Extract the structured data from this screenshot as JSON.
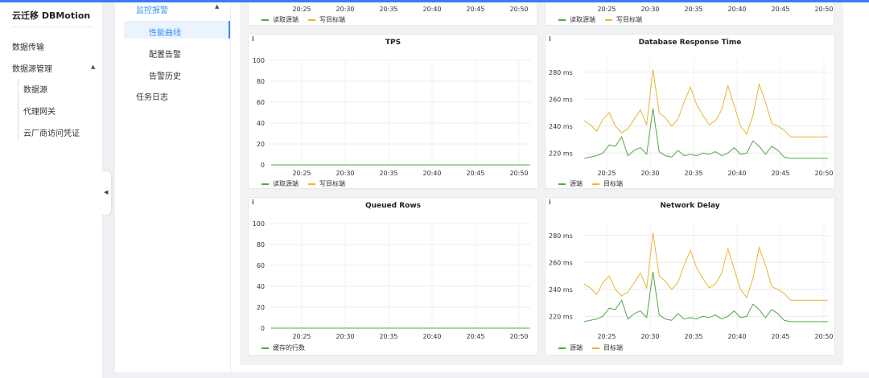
{
  "app": {
    "title": "云迁移 DBMotion"
  },
  "sidebar": {
    "items": [
      {
        "label": "数据传输"
      },
      {
        "label": "数据源管理"
      }
    ],
    "sub_items": [
      {
        "label": "数据源"
      },
      {
        "label": "代理网关"
      },
      {
        "label": "云厂商访问凭证"
      }
    ]
  },
  "secondary_menu": {
    "group": "监控报警",
    "items": [
      {
        "label": "性能曲线",
        "active": true
      },
      {
        "label": "配置告警"
      },
      {
        "label": "告警历史"
      }
    ],
    "other": "任务日志"
  },
  "colors": {
    "series_a": "#56a64b",
    "series_b": "#e5b82f",
    "active_menu": "#3a8ff0"
  },
  "top_partial": {
    "x_ticks": [
      "20:25",
      "20:30",
      "20:35",
      "20:40",
      "20:45",
      "20:50"
    ],
    "left_legend": [
      "读取源端",
      "写目标端"
    ],
    "right_legend": [
      "读取源端",
      "写目标端"
    ]
  },
  "chart_data": [
    {
      "type": "line",
      "title": "TPS",
      "x": [
        "20:25",
        "20:30",
        "20:35",
        "20:40",
        "20:45",
        "20:50"
      ],
      "y_ticks": [
        "0",
        "20",
        "40",
        "60",
        "80",
        "100"
      ],
      "ylim": [
        0,
        100
      ],
      "series": [
        {
          "name": "读取源端",
          "values": [
            0,
            0,
            0,
            0,
            0,
            0
          ]
        },
        {
          "name": "写目标端",
          "values": [
            0,
            0,
            0,
            0,
            0,
            0
          ]
        }
      ]
    },
    {
      "type": "line",
      "title": "Database Response Time",
      "x": [
        "20:25",
        "20:30",
        "20:35",
        "20:40",
        "20:45",
        "20:50"
      ],
      "y_ticks": [
        "220 ms",
        "240 ms",
        "260 ms",
        "280 ms"
      ],
      "ylim": [
        210,
        290
      ],
      "series": [
        {
          "name": "源端",
          "values": [
            216,
            217,
            218,
            220,
            226,
            225,
            232,
            218,
            222,
            224,
            219,
            253,
            221,
            218,
            217,
            222,
            218,
            219,
            218,
            220,
            219,
            221,
            218,
            220,
            224,
            219,
            220,
            229,
            225,
            219,
            225,
            222,
            217,
            216,
            216,
            216,
            216,
            216,
            216,
            216
          ]
        },
        {
          "name": "目标端",
          "values": [
            244,
            241,
            236,
            245,
            250,
            240,
            235,
            238,
            245,
            252,
            241,
            282,
            250,
            246,
            240,
            245,
            258,
            269,
            256,
            248,
            241,
            244,
            252,
            270,
            255,
            240,
            234,
            248,
            271,
            258,
            242,
            240,
            237,
            232,
            232,
            232,
            232,
            232,
            232,
            232
          ]
        }
      ]
    },
    {
      "type": "line",
      "title": "Queued Rows",
      "x": [
        "20:25",
        "20:30",
        "20:35",
        "20:40",
        "20:45",
        "20:50"
      ],
      "y_ticks": [
        "0",
        "20",
        "40",
        "60",
        "80",
        "100"
      ],
      "ylim": [
        0,
        100
      ],
      "series": [
        {
          "name": "缓存的行数",
          "values": [
            0,
            0,
            0,
            0,
            0,
            0
          ]
        }
      ]
    },
    {
      "type": "line",
      "title": "Network Delay",
      "x": [
        "20:25",
        "20:30",
        "20:35",
        "20:40",
        "20:45",
        "20:50"
      ],
      "y_ticks": [
        "220 ms",
        "240 ms",
        "260 ms",
        "280 ms"
      ],
      "ylim": [
        210,
        290
      ],
      "series": [
        {
          "name": "源端",
          "values": [
            216,
            217,
            218,
            220,
            226,
            225,
            232,
            218,
            222,
            224,
            219,
            253,
            221,
            218,
            217,
            222,
            218,
            219,
            218,
            220,
            219,
            221,
            218,
            220,
            224,
            219,
            220,
            229,
            225,
            219,
            225,
            222,
            217,
            216,
            216,
            216,
            216,
            216,
            216,
            216
          ]
        },
        {
          "name": "目标端",
          "values": [
            244,
            241,
            236,
            245,
            250,
            240,
            235,
            238,
            245,
            252,
            241,
            282,
            250,
            246,
            240,
            245,
            258,
            269,
            256,
            248,
            241,
            244,
            252,
            270,
            255,
            240,
            234,
            248,
            271,
            258,
            242,
            240,
            237,
            232,
            232,
            232,
            232,
            232,
            232,
            232
          ]
        }
      ]
    }
  ]
}
